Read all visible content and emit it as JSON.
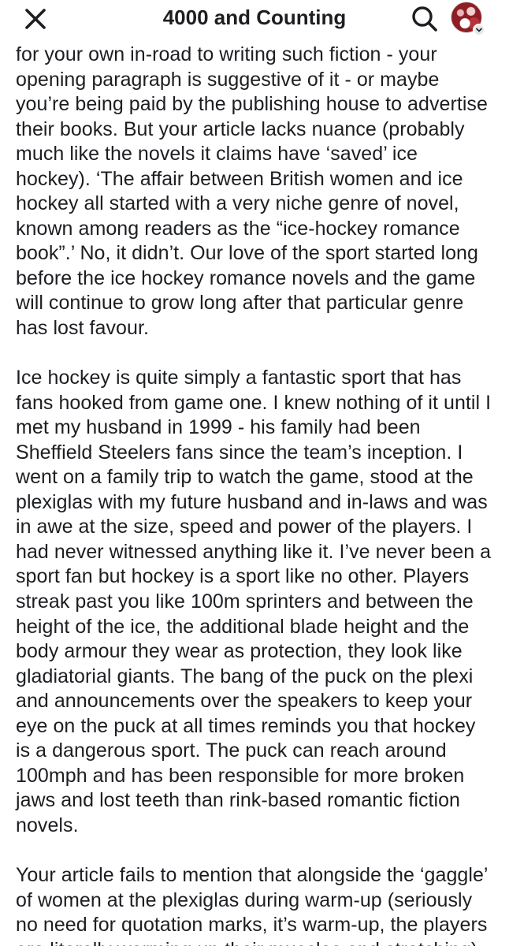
{
  "header": {
    "title": "4000 and Counting",
    "close_icon": "close-icon",
    "search_icon": "search-icon",
    "avatar_icon": "profile-avatar",
    "chevron_icon": "chevron-down-icon"
  },
  "post": {
    "paragraphs": [
      "for your own in-road to writing such fiction - your opening paragraph is suggestive of it - or maybe you’re being paid by the publishing house to advertise their books. But your article lacks nuance (probably much like the novels it claims have ‘saved’ ice hockey). ‘The affair between British women and ice hockey all started with a very niche genre of novel, known among readers as the “ice-hockey romance book”.’ No, it didn’t. Our love of the sport started long before the ice hockey romance novels and the game will continue to grow long after that particular genre has lost favour.",
      "Ice hockey is quite simply a fantastic sport that has fans hooked from game one. I knew nothing of it until I met my husband in 1999 - his family had been Sheffield Steelers fans since the team’s inception. I went on a family trip to watch the game, stood at the plexiglas with my future husband and in-laws and was in awe at the size, speed and power of the players. I had never witnessed anything like it. I’ve never been a sport fan but hockey is a sport like no other. Players streak past you like 100m sprinters and between the height of the ice, the additional blade height and the body armour they wear as protection, they look like gladiatorial giants. The bang of the puck on the plexi and announcements over the speakers to keep your eye on the puck at all times reminds you that hockey is a dangerous sport. The puck can reach around 100mph and has been responsible for more broken jaws and lost teeth than rink-based romantic fiction novels.",
      "Your article fails to mention that alongside the ‘gaggle’ of women at the plexiglas during warm-up (seriously no need for quotation marks, it’s warm-up, the players are literally warming up their muscles and stretching)"
    ]
  },
  "colors": {
    "text": "#1c1e21",
    "background": "#ffffff",
    "avatar_brand": "#8e1d24"
  }
}
